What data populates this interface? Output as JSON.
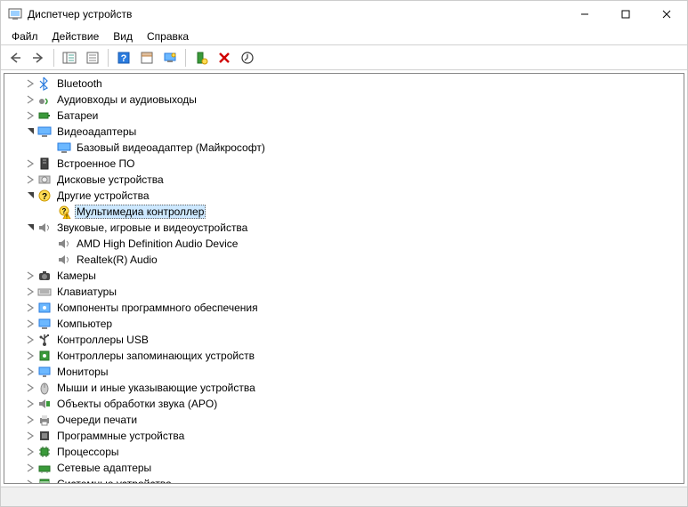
{
  "window": {
    "title": "Диспетчер устройств"
  },
  "menu": {
    "file": "Файл",
    "action": "Действие",
    "view": "Вид",
    "help": "Справка"
  },
  "tree": {
    "items": [
      {
        "label": "Bluetooth",
        "expanded": false,
        "level": 0,
        "icon": "bluetooth",
        "selected": false
      },
      {
        "label": "Аудиовходы и аудиовыходы",
        "expanded": false,
        "level": 0,
        "icon": "audio-io",
        "selected": false
      },
      {
        "label": "Батареи",
        "expanded": false,
        "level": 0,
        "icon": "battery",
        "selected": false
      },
      {
        "label": "Видеоадаптеры",
        "expanded": true,
        "level": 0,
        "icon": "display",
        "selected": false
      },
      {
        "label": "Базовый видеоадаптер (Майкрософт)",
        "expanded": null,
        "level": 1,
        "icon": "display",
        "selected": false
      },
      {
        "label": "Встроенное ПО",
        "expanded": false,
        "level": 0,
        "icon": "firmware",
        "selected": false
      },
      {
        "label": "Дисковые устройства",
        "expanded": false,
        "level": 0,
        "icon": "disk",
        "selected": false
      },
      {
        "label": "Другие устройства",
        "expanded": true,
        "level": 0,
        "icon": "other",
        "selected": false
      },
      {
        "label": "Мультимедиа контроллер",
        "expanded": null,
        "level": 1,
        "icon": "other-warn",
        "selected": true
      },
      {
        "label": "Звуковые, игровые и видеоустройства",
        "expanded": true,
        "level": 0,
        "icon": "sound",
        "selected": false
      },
      {
        "label": "AMD High Definition Audio Device",
        "expanded": null,
        "level": 1,
        "icon": "sound",
        "selected": false
      },
      {
        "label": "Realtek(R) Audio",
        "expanded": null,
        "level": 1,
        "icon": "sound",
        "selected": false
      },
      {
        "label": "Камеры",
        "expanded": false,
        "level": 0,
        "icon": "camera",
        "selected": false
      },
      {
        "label": "Клавиатуры",
        "expanded": false,
        "level": 0,
        "icon": "keyboard",
        "selected": false
      },
      {
        "label": "Компоненты программного обеспечения",
        "expanded": false,
        "level": 0,
        "icon": "software",
        "selected": false
      },
      {
        "label": "Компьютер",
        "expanded": false,
        "level": 0,
        "icon": "computer",
        "selected": false
      },
      {
        "label": "Контроллеры USB",
        "expanded": false,
        "level": 0,
        "icon": "usb",
        "selected": false
      },
      {
        "label": "Контроллеры запоминающих устройств",
        "expanded": false,
        "level": 0,
        "icon": "storage",
        "selected": false
      },
      {
        "label": "Мониторы",
        "expanded": false,
        "level": 0,
        "icon": "monitor",
        "selected": false
      },
      {
        "label": "Мыши и иные указывающие устройства",
        "expanded": false,
        "level": 0,
        "icon": "mouse",
        "selected": false
      },
      {
        "label": "Объекты обработки звука (APO)",
        "expanded": false,
        "level": 0,
        "icon": "apo",
        "selected": false
      },
      {
        "label": "Очереди печати",
        "expanded": false,
        "level": 0,
        "icon": "printer",
        "selected": false
      },
      {
        "label": "Программные устройства",
        "expanded": false,
        "level": 0,
        "icon": "swdevice",
        "selected": false
      },
      {
        "label": "Процессоры",
        "expanded": false,
        "level": 0,
        "icon": "cpu",
        "selected": false
      },
      {
        "label": "Сетевые адаптеры",
        "expanded": false,
        "level": 0,
        "icon": "network",
        "selected": false
      },
      {
        "label": "Системные устройства",
        "expanded": false,
        "level": 0,
        "icon": "system",
        "selected": false
      }
    ]
  }
}
